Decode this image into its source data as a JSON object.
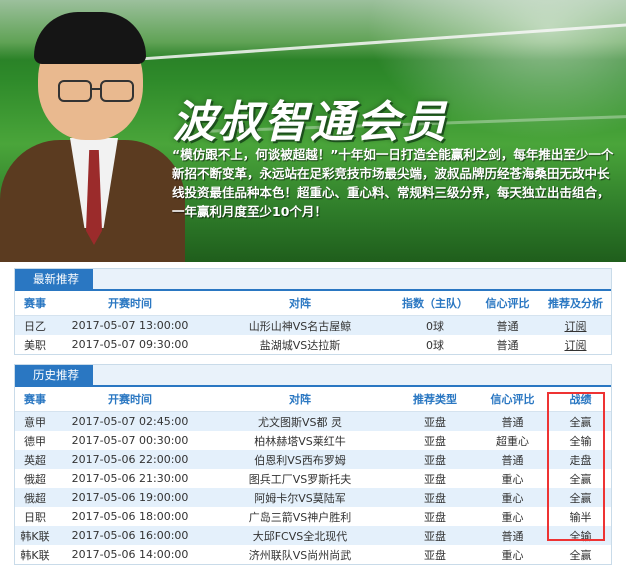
{
  "banner": {
    "title": "波叔智通会员",
    "description": "“模仿跟不上，何谈被超越！”十年如一日打造全能赢利之剑，每年推出至少一个新招不断变革，永远站在足彩竞技市场最尖端，波叔品牌历经苍海桑田无改中长线投资最佳品种本色！超重心、重心料、常规料三级分界，每天独立出击组合，一年赢利月度至少10个月！"
  },
  "latest": {
    "tab": "最新推荐",
    "headers": [
      "赛事",
      "开赛时间",
      "对阵",
      "指数（主队）",
      "信心评比",
      "推荐及分析"
    ],
    "rows": [
      {
        "league": "日乙",
        "time": "2017-05-07 13:00:00",
        "match": "山形山神VS名古屋鲸",
        "index": "0球",
        "confidence": "普通",
        "action": "订阅"
      },
      {
        "league": "美职",
        "time": "2017-05-07 09:30:00",
        "match": "盐湖城VS达拉斯",
        "index": "0球",
        "confidence": "普通",
        "action": "订阅"
      }
    ]
  },
  "history": {
    "tab": "历史推荐",
    "headers": [
      "赛事",
      "开赛时间",
      "对阵",
      "推荐类型",
      "信心评比",
      "战绩"
    ],
    "rows": [
      {
        "league": "意甲",
        "time": "2017-05-07 02:45:00",
        "match": "尤文图斯VS都 灵",
        "type": "亚盘",
        "confidence": "普通",
        "result": "全赢"
      },
      {
        "league": "德甲",
        "time": "2017-05-07 00:30:00",
        "match": "柏林赫塔VS莱红牛",
        "type": "亚盘",
        "confidence": "超重心",
        "result": "全输"
      },
      {
        "league": "英超",
        "time": "2017-05-06 22:00:00",
        "match": "伯恩利VS西布罗姆",
        "type": "亚盘",
        "confidence": "普通",
        "result": "走盘"
      },
      {
        "league": "俄超",
        "time": "2017-05-06 21:30:00",
        "match": "图兵工厂VS罗斯托夫",
        "type": "亚盘",
        "confidence": "重心",
        "result": "全赢"
      },
      {
        "league": "俄超",
        "time": "2017-05-06 19:00:00",
        "match": "阿姆卡尔VS莫陆军",
        "type": "亚盘",
        "confidence": "重心",
        "result": "全赢"
      },
      {
        "league": "日职",
        "time": "2017-05-06 18:00:00",
        "match": "广岛三箭VS神户胜利",
        "type": "亚盘",
        "confidence": "重心",
        "result": "输半"
      },
      {
        "league": "韩K联",
        "time": "2017-05-06 16:00:00",
        "match": "大邱FCVS全北现代",
        "type": "亚盘",
        "confidence": "普通",
        "result": "全输"
      },
      {
        "league": "韩K联",
        "time": "2017-05-06 14:00:00",
        "match": "济州联队VS尚州尚武",
        "type": "亚盘",
        "confidence": "重心",
        "result": "全赢"
      }
    ]
  }
}
